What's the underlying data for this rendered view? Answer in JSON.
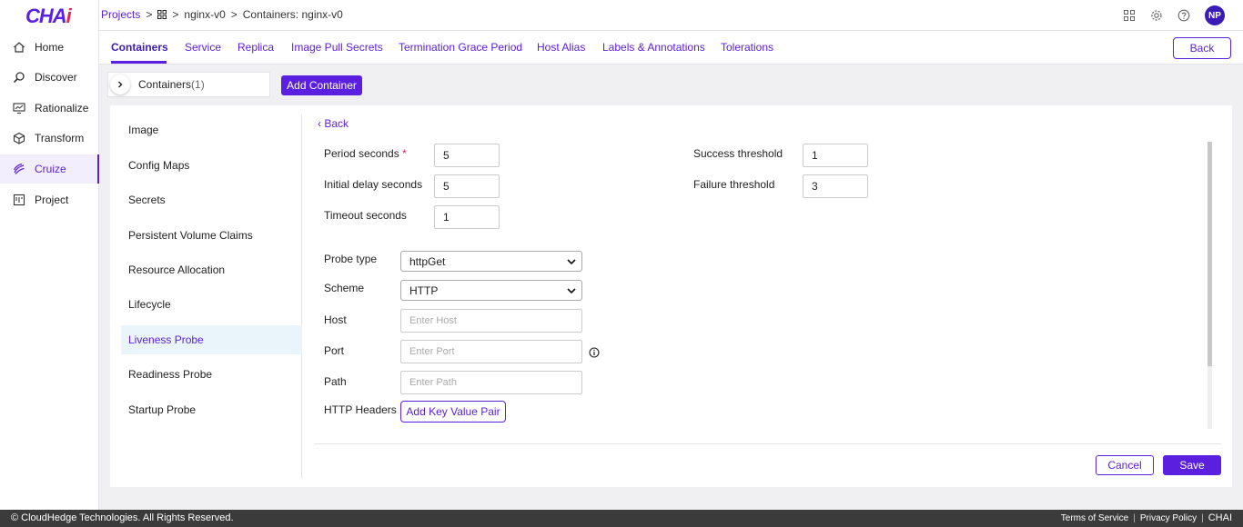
{
  "brand": {
    "logo_main": "CHA",
    "logo_accent": "i"
  },
  "sidebar": {
    "items": [
      {
        "label": "Home",
        "icon": "home-icon"
      },
      {
        "label": "Discover",
        "icon": "discover-icon"
      },
      {
        "label": "Rationalize",
        "icon": "rationalize-icon"
      },
      {
        "label": "Transform",
        "icon": "transform-icon"
      },
      {
        "label": "Cruize",
        "icon": "cruize-icon",
        "active": true
      },
      {
        "label": "Project",
        "icon": "project-icon"
      }
    ]
  },
  "breadcrumb": {
    "projects": "Projects",
    "project": "nginx-v0",
    "current": "Containers: nginx-v0"
  },
  "user": {
    "initials": "NP"
  },
  "tabs": [
    {
      "label": "Containers",
      "active": true
    },
    {
      "label": "Service"
    },
    {
      "label": "Replica"
    },
    {
      "label": "Image Pull Secrets"
    },
    {
      "label": "Termination Grace Period"
    },
    {
      "label": "Host Alias"
    },
    {
      "label": "Labels & Annotations"
    },
    {
      "label": "Tolerations"
    }
  ],
  "header_back": "Back",
  "containers": {
    "label": "Containers",
    "count": "(1)",
    "add_button": "Add Container"
  },
  "left_menu": [
    {
      "label": "Image"
    },
    {
      "label": "Config Maps"
    },
    {
      "label": "Secrets"
    },
    {
      "label": "Persistent Volume Claims"
    },
    {
      "label": "Resource Allocation"
    },
    {
      "label": "Lifecycle"
    },
    {
      "label": "Liveness Probe",
      "active": true
    },
    {
      "label": "Readiness Probe"
    },
    {
      "label": "Startup Probe"
    }
  ],
  "form": {
    "back_label": "Back",
    "period_seconds": {
      "label": "Period seconds",
      "required": "*",
      "value": "5"
    },
    "initial_delay": {
      "label": "Initial delay seconds",
      "value": "5"
    },
    "timeout": {
      "label": "Timeout seconds",
      "value": "1"
    },
    "success_threshold": {
      "label": "Success threshold",
      "value": "1"
    },
    "failure_threshold": {
      "label": "Failure threshold",
      "value": "3"
    },
    "probe_type": {
      "label": "Probe type",
      "value": "httpGet"
    },
    "scheme": {
      "label": "Scheme",
      "value": "HTTP"
    },
    "host": {
      "label": "Host",
      "placeholder": "Enter Host"
    },
    "port": {
      "label": "Port",
      "placeholder": "Enter Port"
    },
    "path": {
      "label": "Path",
      "placeholder": "Enter Path"
    },
    "http_headers": {
      "label": "HTTP Headers",
      "button": "Add Key Value Pair"
    },
    "cancel": "Cancel",
    "save": "Save"
  },
  "footer": {
    "copyright": "© CloudHedge Technologies. All Rights Reserved.",
    "terms": "Terms of Service",
    "privacy": "Privacy Policy",
    "brand": "CHAI"
  },
  "colors": {
    "accent": "#5b1fe0",
    "footer_bg": "#3b3b3b",
    "active_menu_bg": "#eaf4fb"
  }
}
